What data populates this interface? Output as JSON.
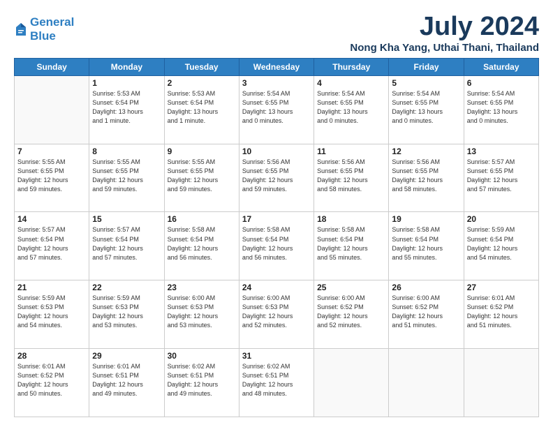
{
  "header": {
    "logo_line1": "General",
    "logo_line2": "Blue",
    "month": "July 2024",
    "location": "Nong Kha Yang, Uthai Thani, Thailand"
  },
  "weekdays": [
    "Sunday",
    "Monday",
    "Tuesday",
    "Wednesday",
    "Thursday",
    "Friday",
    "Saturday"
  ],
  "weeks": [
    [
      {
        "day": "",
        "detail": ""
      },
      {
        "day": "1",
        "detail": "Sunrise: 5:53 AM\nSunset: 6:54 PM\nDaylight: 13 hours\nand 1 minute."
      },
      {
        "day": "2",
        "detail": "Sunrise: 5:53 AM\nSunset: 6:54 PM\nDaylight: 13 hours\nand 1 minute."
      },
      {
        "day": "3",
        "detail": "Sunrise: 5:54 AM\nSunset: 6:55 PM\nDaylight: 13 hours\nand 0 minutes."
      },
      {
        "day": "4",
        "detail": "Sunrise: 5:54 AM\nSunset: 6:55 PM\nDaylight: 13 hours\nand 0 minutes."
      },
      {
        "day": "5",
        "detail": "Sunrise: 5:54 AM\nSunset: 6:55 PM\nDaylight: 13 hours\nand 0 minutes."
      },
      {
        "day": "6",
        "detail": "Sunrise: 5:54 AM\nSunset: 6:55 PM\nDaylight: 13 hours\nand 0 minutes."
      }
    ],
    [
      {
        "day": "7",
        "detail": "Sunrise: 5:55 AM\nSunset: 6:55 PM\nDaylight: 12 hours\nand 59 minutes."
      },
      {
        "day": "8",
        "detail": "Sunrise: 5:55 AM\nSunset: 6:55 PM\nDaylight: 12 hours\nand 59 minutes."
      },
      {
        "day": "9",
        "detail": "Sunrise: 5:55 AM\nSunset: 6:55 PM\nDaylight: 12 hours\nand 59 minutes."
      },
      {
        "day": "10",
        "detail": "Sunrise: 5:56 AM\nSunset: 6:55 PM\nDaylight: 12 hours\nand 59 minutes."
      },
      {
        "day": "11",
        "detail": "Sunrise: 5:56 AM\nSunset: 6:55 PM\nDaylight: 12 hours\nand 58 minutes."
      },
      {
        "day": "12",
        "detail": "Sunrise: 5:56 AM\nSunset: 6:55 PM\nDaylight: 12 hours\nand 58 minutes."
      },
      {
        "day": "13",
        "detail": "Sunrise: 5:57 AM\nSunset: 6:55 PM\nDaylight: 12 hours\nand 57 minutes."
      }
    ],
    [
      {
        "day": "14",
        "detail": "Sunrise: 5:57 AM\nSunset: 6:54 PM\nDaylight: 12 hours\nand 57 minutes."
      },
      {
        "day": "15",
        "detail": "Sunrise: 5:57 AM\nSunset: 6:54 PM\nDaylight: 12 hours\nand 57 minutes."
      },
      {
        "day": "16",
        "detail": "Sunrise: 5:58 AM\nSunset: 6:54 PM\nDaylight: 12 hours\nand 56 minutes."
      },
      {
        "day": "17",
        "detail": "Sunrise: 5:58 AM\nSunset: 6:54 PM\nDaylight: 12 hours\nand 56 minutes."
      },
      {
        "day": "18",
        "detail": "Sunrise: 5:58 AM\nSunset: 6:54 PM\nDaylight: 12 hours\nand 55 minutes."
      },
      {
        "day": "19",
        "detail": "Sunrise: 5:58 AM\nSunset: 6:54 PM\nDaylight: 12 hours\nand 55 minutes."
      },
      {
        "day": "20",
        "detail": "Sunrise: 5:59 AM\nSunset: 6:54 PM\nDaylight: 12 hours\nand 54 minutes."
      }
    ],
    [
      {
        "day": "21",
        "detail": "Sunrise: 5:59 AM\nSunset: 6:53 PM\nDaylight: 12 hours\nand 54 minutes."
      },
      {
        "day": "22",
        "detail": "Sunrise: 5:59 AM\nSunset: 6:53 PM\nDaylight: 12 hours\nand 53 minutes."
      },
      {
        "day": "23",
        "detail": "Sunrise: 6:00 AM\nSunset: 6:53 PM\nDaylight: 12 hours\nand 53 minutes."
      },
      {
        "day": "24",
        "detail": "Sunrise: 6:00 AM\nSunset: 6:53 PM\nDaylight: 12 hours\nand 52 minutes."
      },
      {
        "day": "25",
        "detail": "Sunrise: 6:00 AM\nSunset: 6:52 PM\nDaylight: 12 hours\nand 52 minutes."
      },
      {
        "day": "26",
        "detail": "Sunrise: 6:00 AM\nSunset: 6:52 PM\nDaylight: 12 hours\nand 51 minutes."
      },
      {
        "day": "27",
        "detail": "Sunrise: 6:01 AM\nSunset: 6:52 PM\nDaylight: 12 hours\nand 51 minutes."
      }
    ],
    [
      {
        "day": "28",
        "detail": "Sunrise: 6:01 AM\nSunset: 6:52 PM\nDaylight: 12 hours\nand 50 minutes."
      },
      {
        "day": "29",
        "detail": "Sunrise: 6:01 AM\nSunset: 6:51 PM\nDaylight: 12 hours\nand 49 minutes."
      },
      {
        "day": "30",
        "detail": "Sunrise: 6:02 AM\nSunset: 6:51 PM\nDaylight: 12 hours\nand 49 minutes."
      },
      {
        "day": "31",
        "detail": "Sunrise: 6:02 AM\nSunset: 6:51 PM\nDaylight: 12 hours\nand 48 minutes."
      },
      {
        "day": "",
        "detail": ""
      },
      {
        "day": "",
        "detail": ""
      },
      {
        "day": "",
        "detail": ""
      }
    ]
  ]
}
